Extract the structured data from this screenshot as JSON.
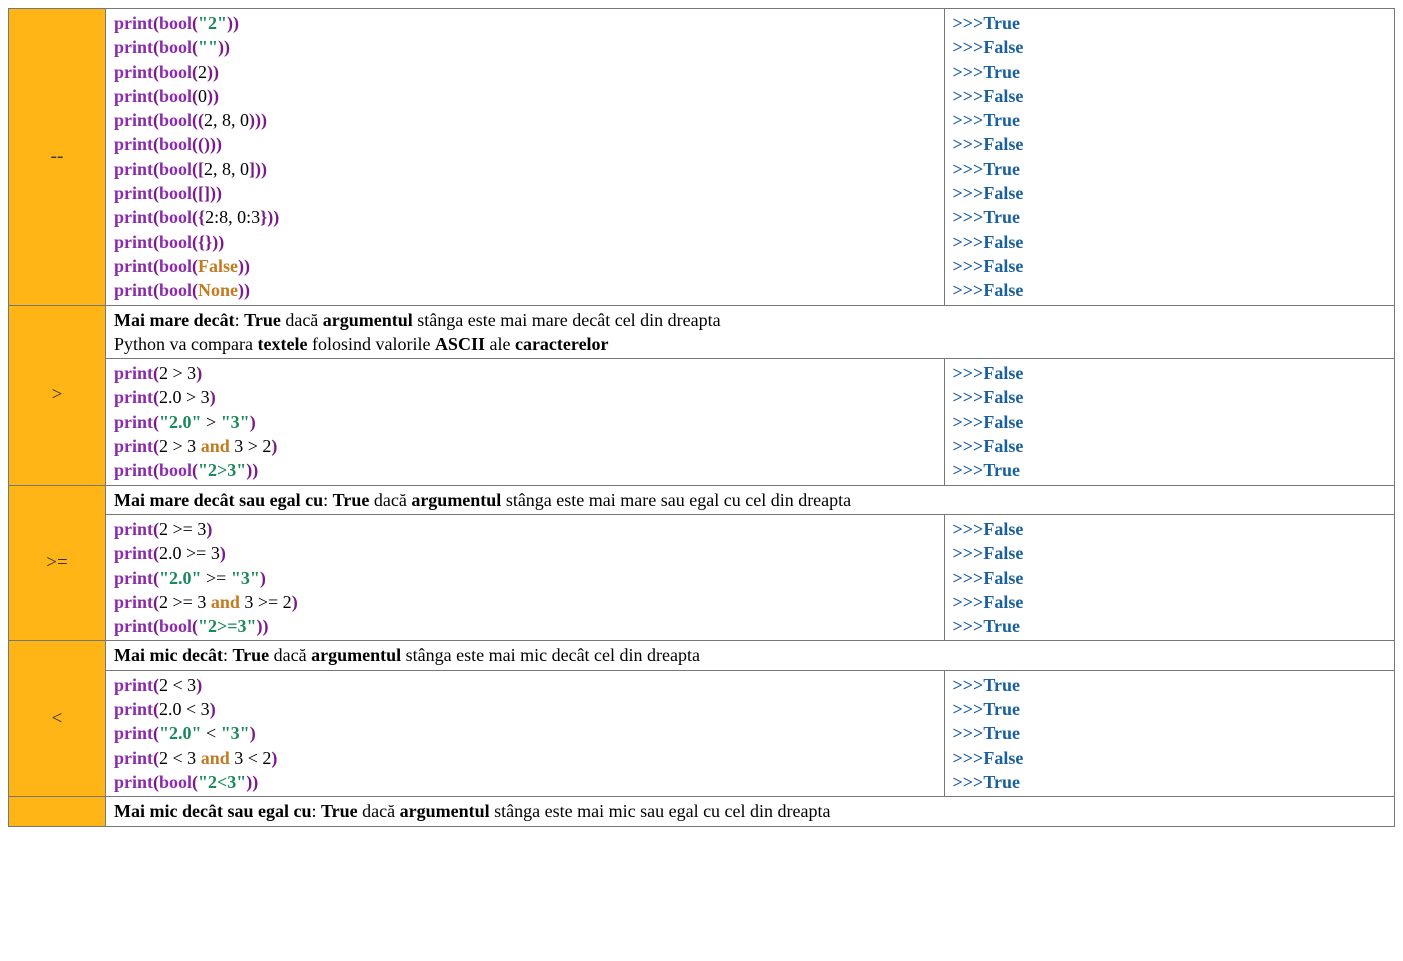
{
  "operators": [
    {
      "symbol": "--",
      "description": null,
      "code": [
        [
          {
            "t": "print",
            "c": "k-print"
          },
          {
            "t": "(",
            "c": "paren"
          },
          {
            "t": "bool",
            "c": "k-bool"
          },
          {
            "t": "(",
            "c": "paren"
          },
          {
            "t": "\"2\"",
            "c": "str"
          },
          {
            "t": "))",
            "c": "paren"
          }
        ],
        [
          {
            "t": "print",
            "c": "k-print"
          },
          {
            "t": "(",
            "c": "paren"
          },
          {
            "t": "bool",
            "c": "k-bool"
          },
          {
            "t": "(",
            "c": "paren"
          },
          {
            "t": "\"\"",
            "c": "str"
          },
          {
            "t": "))",
            "c": "paren"
          }
        ],
        [
          {
            "t": "print",
            "c": "k-print"
          },
          {
            "t": "(",
            "c": "paren"
          },
          {
            "t": "bool",
            "c": "k-bool"
          },
          {
            "t": "(",
            "c": "paren"
          },
          {
            "t": "2",
            "c": "plain"
          },
          {
            "t": "))",
            "c": "paren"
          }
        ],
        [
          {
            "t": "print",
            "c": "k-print"
          },
          {
            "t": "(",
            "c": "paren"
          },
          {
            "t": "bool",
            "c": "k-bool"
          },
          {
            "t": "(",
            "c": "paren"
          },
          {
            "t": "0",
            "c": "plain"
          },
          {
            "t": "))",
            "c": "paren"
          }
        ],
        [
          {
            "t": "print",
            "c": "k-print"
          },
          {
            "t": "(",
            "c": "paren"
          },
          {
            "t": "bool",
            "c": "k-bool"
          },
          {
            "t": "((",
            "c": "paren"
          },
          {
            "t": "2, 8, 0",
            "c": "plain"
          },
          {
            "t": ")))",
            "c": "paren"
          }
        ],
        [
          {
            "t": "print",
            "c": "k-print"
          },
          {
            "t": "(",
            "c": "paren"
          },
          {
            "t": "bool",
            "c": "k-bool"
          },
          {
            "t": "(()",
            "c": "paren"
          },
          {
            "t": "))",
            "c": "paren"
          }
        ],
        [
          {
            "t": "print",
            "c": "k-print"
          },
          {
            "t": "(",
            "c": "paren"
          },
          {
            "t": "bool",
            "c": "k-bool"
          },
          {
            "t": "([",
            "c": "paren"
          },
          {
            "t": "2, 8, 0",
            "c": "plain"
          },
          {
            "t": "]))",
            "c": "paren"
          }
        ],
        [
          {
            "t": "print",
            "c": "k-print"
          },
          {
            "t": "(",
            "c": "paren"
          },
          {
            "t": "bool",
            "c": "k-bool"
          },
          {
            "t": "([]))",
            "c": "paren"
          }
        ],
        [
          {
            "t": "print",
            "c": "k-print"
          },
          {
            "t": "(",
            "c": "paren"
          },
          {
            "t": "bool",
            "c": "k-bool"
          },
          {
            "t": "({",
            "c": "paren"
          },
          {
            "t": "2:8, 0:3",
            "c": "plain"
          },
          {
            "t": "}))",
            "c": "paren"
          }
        ],
        [
          {
            "t": "print",
            "c": "k-print"
          },
          {
            "t": "(",
            "c": "paren"
          },
          {
            "t": "bool",
            "c": "k-bool"
          },
          {
            "t": "({}))",
            "c": "paren"
          }
        ],
        [
          {
            "t": "print",
            "c": "k-print"
          },
          {
            "t": "(",
            "c": "paren"
          },
          {
            "t": "bool",
            "c": "k-bool"
          },
          {
            "t": "(",
            "c": "paren"
          },
          {
            "t": "False",
            "c": "const"
          },
          {
            "t": "))",
            "c": "paren"
          }
        ],
        [
          {
            "t": "print",
            "c": "k-print"
          },
          {
            "t": "(",
            "c": "paren"
          },
          {
            "t": "bool",
            "c": "k-bool"
          },
          {
            "t": "(",
            "c": "paren"
          },
          {
            "t": "None",
            "c": "const"
          },
          {
            "t": "))",
            "c": "paren"
          }
        ]
      ],
      "output": [
        "True",
        "False",
        "True",
        "False",
        "True",
        "False",
        "True",
        "False",
        "True",
        "False",
        "False",
        "False"
      ]
    },
    {
      "symbol": ">",
      "description": [
        {
          "t": "Mai mare decât",
          "b": true
        },
        {
          "t": ": ",
          "b": false
        },
        {
          "t": "True",
          "b": true
        },
        {
          "t": " dacă ",
          "b": false
        },
        {
          "t": "argumentul",
          "b": true
        },
        {
          "t": " stânga este mai mare decât cel din dreapta",
          "b": false
        },
        {
          "t": "\n",
          "b": false
        },
        {
          "t": "Python va compara ",
          "b": false
        },
        {
          "t": "textele",
          "b": true
        },
        {
          "t": " folosind valorile ",
          "b": false
        },
        {
          "t": "ASCII",
          "b": true
        },
        {
          "t": " ale ",
          "b": false
        },
        {
          "t": "caracterelor",
          "b": true
        }
      ],
      "code": [
        [
          {
            "t": "print",
            "c": "k-print"
          },
          {
            "t": "(",
            "c": "paren"
          },
          {
            "t": "2 > 3",
            "c": "plain"
          },
          {
            "t": ")",
            "c": "paren"
          }
        ],
        [
          {
            "t": "print",
            "c": "k-print"
          },
          {
            "t": "(",
            "c": "paren"
          },
          {
            "t": "2.0 > 3",
            "c": "plain"
          },
          {
            "t": ")",
            "c": "paren"
          }
        ],
        [
          {
            "t": "print",
            "c": "k-print"
          },
          {
            "t": "(",
            "c": "paren"
          },
          {
            "t": "\"2.0\"",
            "c": "str"
          },
          {
            "t": " > ",
            "c": "plain"
          },
          {
            "t": "\"3\"",
            "c": "str"
          },
          {
            "t": ")",
            "c": "paren"
          }
        ],
        [
          {
            "t": "print",
            "c": "k-print"
          },
          {
            "t": "(",
            "c": "paren"
          },
          {
            "t": "2 > 3 ",
            "c": "plain"
          },
          {
            "t": "and",
            "c": "const"
          },
          {
            "t": " 3 > 2",
            "c": "plain"
          },
          {
            "t": ")",
            "c": "paren"
          }
        ],
        [
          {
            "t": "print",
            "c": "k-print"
          },
          {
            "t": "(",
            "c": "paren"
          },
          {
            "t": "bool",
            "c": "k-bool"
          },
          {
            "t": "(",
            "c": "paren"
          },
          {
            "t": "\"2>3\"",
            "c": "str"
          },
          {
            "t": "))",
            "c": "paren"
          }
        ]
      ],
      "output": [
        "False",
        "False",
        "False",
        "False",
        "True"
      ]
    },
    {
      "symbol": ">=",
      "description": [
        {
          "t": "Mai mare decât sau egal cu",
          "b": true
        },
        {
          "t": ": ",
          "b": false
        },
        {
          "t": "True",
          "b": true
        },
        {
          "t": " dacă ",
          "b": false
        },
        {
          "t": "argumentul",
          "b": true
        },
        {
          "t": " stânga este mai mare sau egal cu cel din dreapta",
          "b": false
        }
      ],
      "code": [
        [
          {
            "t": "print",
            "c": "k-print"
          },
          {
            "t": "(",
            "c": "paren"
          },
          {
            "t": "2 >= 3",
            "c": "plain"
          },
          {
            "t": ")",
            "c": "paren"
          }
        ],
        [
          {
            "t": "print",
            "c": "k-print"
          },
          {
            "t": "(",
            "c": "paren"
          },
          {
            "t": "2.0 >= 3",
            "c": "plain"
          },
          {
            "t": ")",
            "c": "paren"
          }
        ],
        [
          {
            "t": "print",
            "c": "k-print"
          },
          {
            "t": "(",
            "c": "paren"
          },
          {
            "t": "\"2.0\"",
            "c": "str"
          },
          {
            "t": " >= ",
            "c": "plain"
          },
          {
            "t": "\"3\"",
            "c": "str"
          },
          {
            "t": ")",
            "c": "paren"
          }
        ],
        [
          {
            "t": "print",
            "c": "k-print"
          },
          {
            "t": "(",
            "c": "paren"
          },
          {
            "t": "2 >= 3 ",
            "c": "plain"
          },
          {
            "t": "and",
            "c": "const"
          },
          {
            "t": " 3 >= 2",
            "c": "plain"
          },
          {
            "t": ")",
            "c": "paren"
          }
        ],
        [
          {
            "t": "print",
            "c": "k-print"
          },
          {
            "t": "(",
            "c": "paren"
          },
          {
            "t": "bool",
            "c": "k-bool"
          },
          {
            "t": "(",
            "c": "paren"
          },
          {
            "t": "\"2>=3\"",
            "c": "str"
          },
          {
            "t": "))",
            "c": "paren"
          }
        ]
      ],
      "output": [
        "False",
        "False",
        "False",
        "False",
        "True"
      ]
    },
    {
      "symbol": "<",
      "description": [
        {
          "t": "Mai mic decât",
          "b": true
        },
        {
          "t": ": ",
          "b": false
        },
        {
          "t": "True",
          "b": true
        },
        {
          "t": " dacă ",
          "b": false
        },
        {
          "t": "argumentul",
          "b": true
        },
        {
          "t": " stânga este mai mic decât cel din dreapta",
          "b": false
        }
      ],
      "code": [
        [
          {
            "t": "print",
            "c": "k-print"
          },
          {
            "t": "(",
            "c": "paren"
          },
          {
            "t": "2 < 3",
            "c": "plain"
          },
          {
            "t": ")",
            "c": "paren"
          }
        ],
        [
          {
            "t": "print",
            "c": "k-print"
          },
          {
            "t": "(",
            "c": "paren"
          },
          {
            "t": "2.0 < 3",
            "c": "plain"
          },
          {
            "t": ")",
            "c": "paren"
          }
        ],
        [
          {
            "t": "print",
            "c": "k-print"
          },
          {
            "t": "(",
            "c": "paren"
          },
          {
            "t": "\"2.0\"",
            "c": "str"
          },
          {
            "t": " < ",
            "c": "plain"
          },
          {
            "t": "\"3\"",
            "c": "str"
          },
          {
            "t": ")",
            "c": "paren"
          }
        ],
        [
          {
            "t": "print",
            "c": "k-print"
          },
          {
            "t": "(",
            "c": "paren"
          },
          {
            "t": "2 < 3 ",
            "c": "plain"
          },
          {
            "t": "and",
            "c": "const"
          },
          {
            "t": " 3 < 2",
            "c": "plain"
          },
          {
            "t": ")",
            "c": "paren"
          }
        ],
        [
          {
            "t": "print",
            "c": "k-print"
          },
          {
            "t": "(",
            "c": "paren"
          },
          {
            "t": "bool",
            "c": "k-bool"
          },
          {
            "t": "(",
            "c": "paren"
          },
          {
            "t": "\"2<3\"",
            "c": "str"
          },
          {
            "t": "))",
            "c": "paren"
          }
        ]
      ],
      "output": [
        "True",
        "True",
        "True",
        "False",
        "True"
      ]
    },
    {
      "symbol": "",
      "descriptionOnly": true,
      "description": [
        {
          "t": "Mai mic decât sau egal cu",
          "b": true
        },
        {
          "t": ": ",
          "b": false
        },
        {
          "t": "True",
          "b": true
        },
        {
          "t": " dacă ",
          "b": false
        },
        {
          "t": "argumentul",
          "b": true
        },
        {
          "t": " stânga este mai mic sau egal cu cel din dreapta",
          "b": false
        }
      ]
    }
  ],
  "prompt": ">>>"
}
